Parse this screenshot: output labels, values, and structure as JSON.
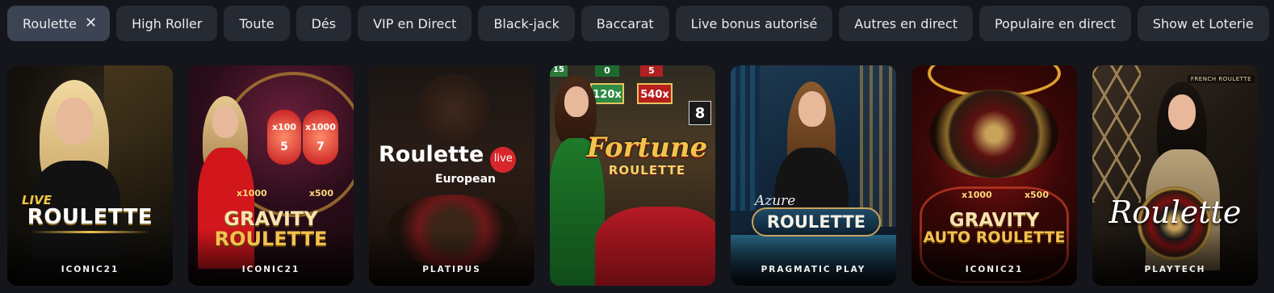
{
  "filters": {
    "active": {
      "label": "Roulette",
      "close_icon": "close-icon"
    },
    "items": [
      "High Roller",
      "Toute",
      "Dés",
      "VIP en Direct",
      "Black-jack",
      "Baccarat",
      "Live bonus autorisé",
      "Autres en direct",
      "Populaire en direct",
      "Show et Loterie"
    ]
  },
  "games": [
    {
      "line1": "LIVE",
      "line2": "ROULETTE",
      "provider": "ICONIC21"
    },
    {
      "badge_left": "x100",
      "badge_right": "x1000",
      "num_left": "5",
      "num_right": "7",
      "multi_left": "x1000",
      "multi_right": "x500",
      "line1": "GRAVITY",
      "line2": "ROULETTE",
      "provider": "ICONIC21"
    },
    {
      "title": "Roulette",
      "badge": "live",
      "subtitle": "European",
      "provider": "PLATIPUS"
    },
    {
      "top_left": "15",
      "top_mid": "0",
      "top_right": "5",
      "multi_mid": "120x",
      "multi_right": "540x",
      "side_num": "8",
      "line1": "Fortune",
      "line2": "ROULETTE",
      "provider": ""
    },
    {
      "line1": "Azure",
      "line2": "ROULETTE",
      "provider": "PRAGMATIC PLAY"
    },
    {
      "multi_left": "x1000",
      "multi_right": "x500",
      "line1": "GRAVITY",
      "line2": "AUTO ROULETTE",
      "provider": "ICONIC21"
    },
    {
      "corner": "FRENCH ROULETTE",
      "line1": "Roulette",
      "provider": "PLAYTECH"
    }
  ],
  "colors": {
    "background": "#14161c",
    "chip": "#262a33",
    "chip_active": "#3c4352",
    "gold": "#f2c14e",
    "live_red": "#d7262c"
  }
}
